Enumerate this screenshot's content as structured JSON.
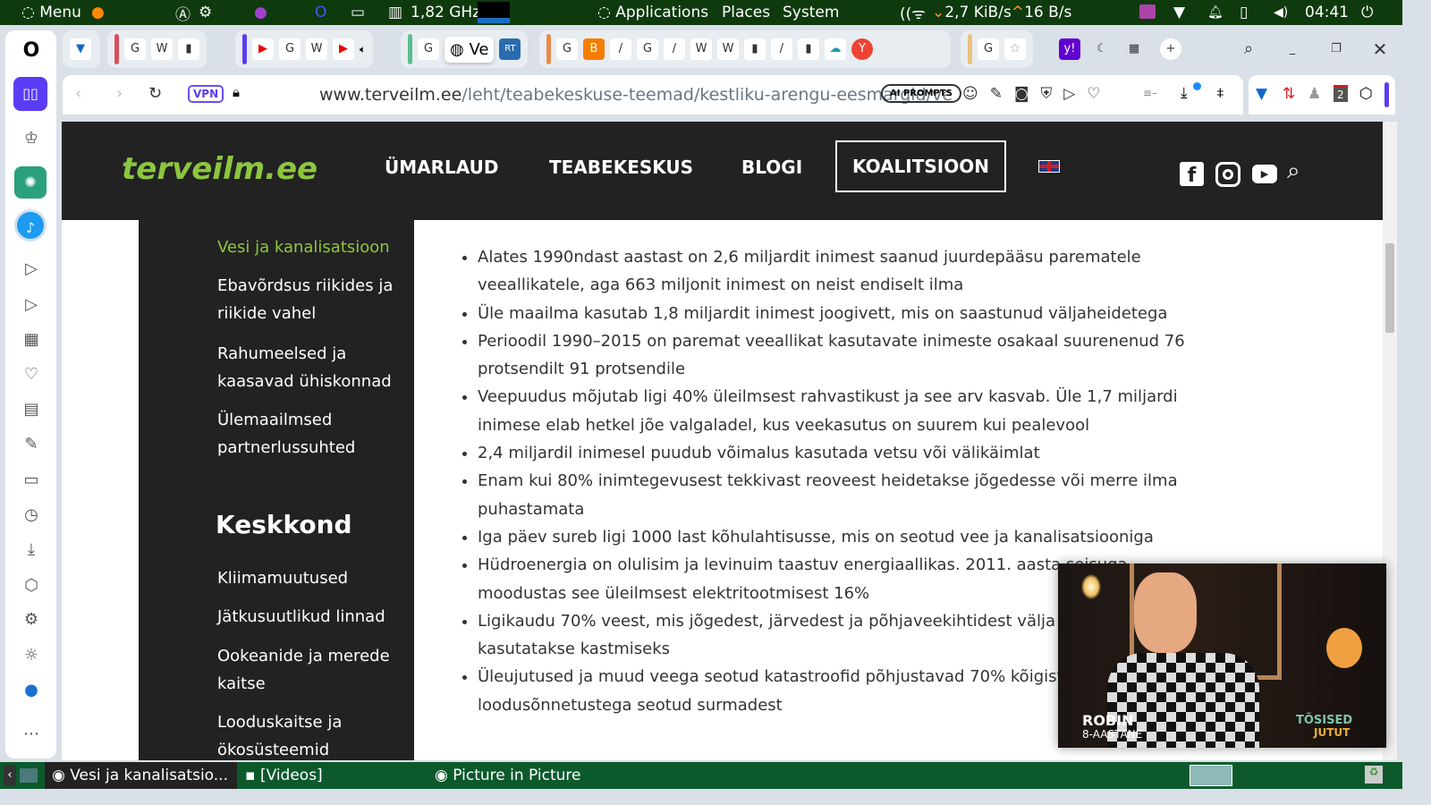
{
  "panel": {
    "menu": "Menu",
    "cpu": "1,82 GHz",
    "applications": "Applications",
    "places": "Places",
    "system": "System",
    "net_down": "2,7 KiB/s",
    "net_up": "16 B/s",
    "clock": "04:41"
  },
  "tabs": {
    "active_label": "Ve"
  },
  "address": {
    "vpn": "VPN",
    "url_domain": "www.terveilm.ee",
    "url_path": "/leht/teabekeskuse-teemad/kestliku-arengu-eesmargid/ve",
    "ai_prompts": "AI PROMPTS",
    "ext_badge": "2"
  },
  "site": {
    "logo": "terveilm.ee",
    "nav": [
      "ÜMARLAUD",
      "TEABEKESKUS",
      "BLOGI",
      "KOALITSIOON"
    ],
    "sidebar_links": [
      "Vesi ja kanalisatsioon",
      "Ebavõrdsus riikides ja riikide vahel",
      "Rahumeelsed ja kaasavad ühiskonnad",
      "Ülemaailmsed partnerlussuhted"
    ],
    "section_heading": "Keskkond",
    "section_links": [
      "Kliimamuutused",
      "Jätkusuutlikud linnad",
      "Ookeanide ja merede kaitse",
      "Looduskaitse ja ökosüsteemid"
    ],
    "bullets": [
      "Alates 1990ndast aastast on 2,6 miljardit inimest saanud juurdepääsu parematele veeallikatele, aga 663 miljonit inimest on neist endiselt ilma",
      "Üle maailma kasutab 1,8 miljardit inimest joogivett, mis on saastunud väljaheidetega",
      "Perioodil 1990–2015 on paremat veeallikat kasutavate inimeste osakaal suurenenud 76 protsendilt 91 protsendile",
      "Veepuudus mõjutab ligi 40% üleilmsest rahvastikust ja see arv kasvab. Üle 1,7 miljardi inimese elab hetkel jõe valgaladel, kus veekasutus on suurem kui pealevool",
      "2,4 miljardil inimesel puudub võimalus kasutada vetsu või välikäimlat",
      "Enam kui 80% inimtegevusest tekkivast reoveest heidetakse jõgedesse või merre ilma puhastamata",
      "Iga päev sureb ligi 1000 last kõhulahtisusse, mis on seotud vee ja kanalisatsiooniga",
      "Hüdroenergia on olulisim ja levinuim taastuv energiaallikas. 2011. aasta seisuga moodustas see üleilmsest elektritootmisest 16%",
      "Ligikaudu 70% veest, mis jõgedest, järvedest ja põhjaveekihtidest välja pumbatakse, kasutatakse kastmiseks",
      "Üleujutused ja muud veega seotud katastroofid põhjustavad 70% kõigist loodusõnnetustega seotud surmadest"
    ]
  },
  "pip": {
    "name": "ROBIN",
    "subtitle": "8-AASTANE",
    "brand1": "TÕSISED",
    "brand2": "JUTUT"
  },
  "taskbar": {
    "items": [
      "Vesi ja kanalisatsio...",
      "[Videos]",
      "Picture in Picture"
    ]
  }
}
